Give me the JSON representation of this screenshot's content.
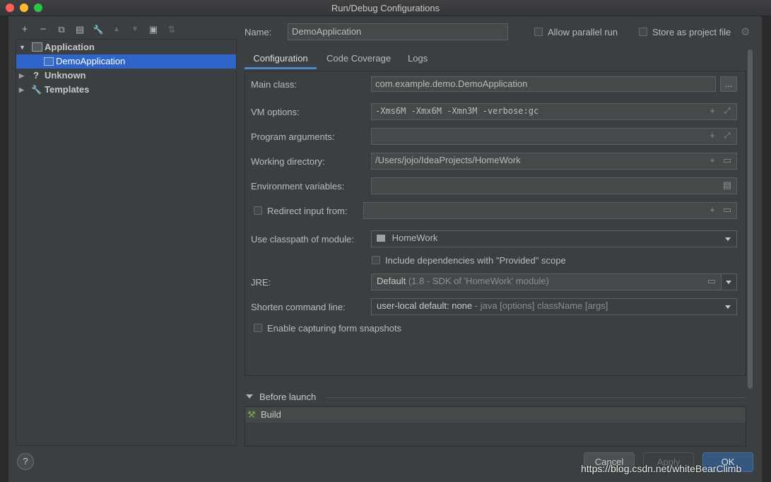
{
  "window": {
    "title": "Run/Debug Configurations"
  },
  "toolbar": {
    "add": "+",
    "remove": "−",
    "copy": "⧉",
    "save": "▤",
    "edit": "🔧",
    "up": "▲",
    "down": "▼",
    "folder": "▣",
    "sort": "⇅"
  },
  "tree": {
    "items": [
      {
        "label": "Application",
        "expanded": true
      },
      {
        "label": "DemoApplication",
        "selected": true
      },
      {
        "label": "Unknown"
      },
      {
        "label": "Templates"
      }
    ]
  },
  "header": {
    "name_label": "Name:",
    "name_value": "DemoApplication",
    "allow_parallel_label": "Allow parallel run",
    "store_project_label": "Store as project file"
  },
  "tabs": [
    "Configuration",
    "Code Coverage",
    "Logs"
  ],
  "form": {
    "main_class_label": "Main class:",
    "main_class_value": "com.example.demo.DemoApplication",
    "browse_label": "...",
    "vm_options_label": "VM options:",
    "vm_options_value": "-Xms6M -Xmx6M -Xmn3M -verbose:gc",
    "program_args_label": "Program arguments:",
    "program_args_value": "",
    "working_dir_label": "Working directory:",
    "working_dir_value": "/Users/jojo/IdeaProjects/HomeWork",
    "env_vars_label": "Environment variables:",
    "env_vars_value": "",
    "redirect_label": "Redirect input from:",
    "redirect_value": "",
    "classpath_label": "Use classpath of module:",
    "classpath_value": "HomeWork",
    "include_deps_label": "Include dependencies with \"Provided\" scope",
    "jre_label": "JRE:",
    "jre_value": "Default",
    "jre_hint": "(1.8 - SDK of 'HomeWork' module)",
    "shorten_label": "Shorten command line:",
    "shorten_value": "user-local default: none",
    "shorten_hint": "- java [options] className [args]",
    "snapshots_label": "Enable capturing form snapshots"
  },
  "before_launch": {
    "title": "Before launch",
    "items": [
      "Build"
    ]
  },
  "buttons": {
    "cancel": "Cancel",
    "apply": "Apply",
    "ok": "OK",
    "help": "?"
  },
  "watermark": "https://blog.csdn.net/whiteBearClimb",
  "colors": {
    "selection": "#2f65ca",
    "ok_button": "#365880",
    "panel": "#3c3f41"
  }
}
